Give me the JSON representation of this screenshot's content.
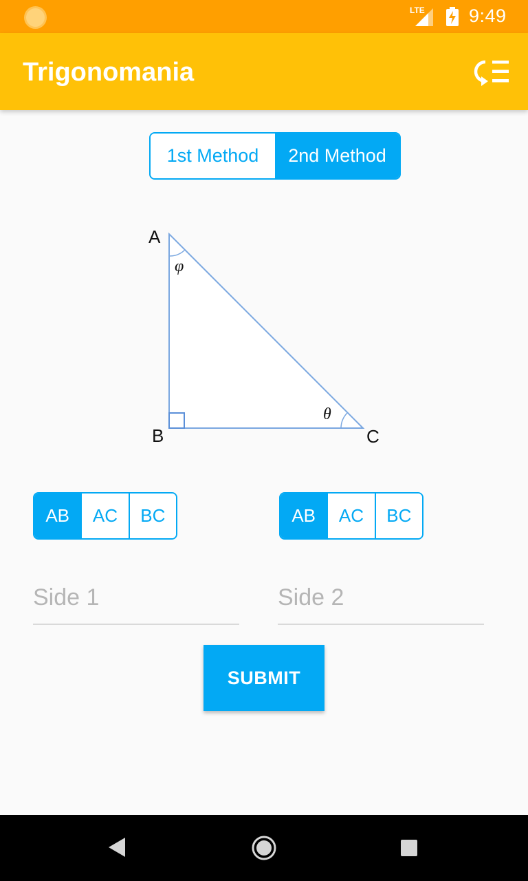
{
  "status_bar": {
    "network_label": "LTE",
    "time": "9:49",
    "icons": [
      "weather-icon",
      "lte-signal-icon",
      "battery-charging-icon"
    ]
  },
  "app_bar": {
    "title": "Trigonomania",
    "menu_icon": "history-list-icon",
    "background_color": "#ffc107"
  },
  "method_toggle": {
    "options": [
      "1st Method",
      "2nd Method"
    ],
    "selected": "2nd Method"
  },
  "diagram": {
    "vertices": [
      "A",
      "B",
      "C"
    ],
    "angle_labels": {
      "at_A": "φ",
      "at_C": "θ"
    },
    "right_angle_at": "B"
  },
  "side_selectors": [
    {
      "options": [
        "AB",
        "AC",
        "BC"
      ],
      "selected": "AB"
    },
    {
      "options": [
        "AB",
        "AC",
        "BC"
      ],
      "selected": "AB"
    }
  ],
  "inputs": {
    "side1": {
      "placeholder": "Side 1",
      "value": ""
    },
    "side2": {
      "placeholder": "Side 2",
      "value": ""
    }
  },
  "submit_label": "SUBMIT",
  "nav_bar": {
    "icons": [
      "back-icon",
      "home-icon",
      "recents-icon"
    ]
  },
  "colors": {
    "status_bar": "#ff9f00",
    "accent": "#03a9f4"
  }
}
